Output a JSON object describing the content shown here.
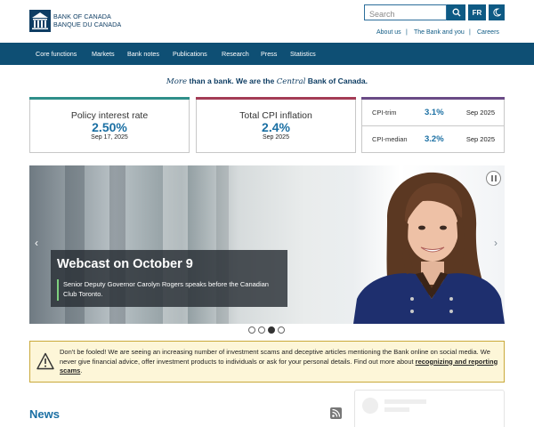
{
  "header": {
    "logo_line1": "BANK OF CANADA",
    "logo_line2": "BANQUE DU CANADA",
    "search_placeholder": "Search",
    "lang_button": "FR",
    "utility_links": [
      "About us",
      "The Bank and you",
      "Careers"
    ]
  },
  "nav": {
    "items": [
      "Core functions",
      "Markets",
      "Bank notes",
      "Publications",
      "Research",
      "Press",
      "Statistics"
    ]
  },
  "tagline": {
    "part1": "More",
    "part2": " than a bank. We are the ",
    "part3": "Central",
    "part4": " Bank of Canada."
  },
  "stats": {
    "policy": {
      "title": "Policy interest rate",
      "value": "2.50%",
      "date": "Sep 17, 2025"
    },
    "cpi": {
      "title": "Total CPI inflation",
      "value": "2.4%",
      "date": "Sep 2025"
    },
    "cpi_trim": {
      "label": "CPI-trim",
      "value": "3.1%",
      "date": "Sep 2025"
    },
    "cpi_median": {
      "label": "CPI-median",
      "value": "3.2%",
      "date": "Sep 2025"
    }
  },
  "carousel": {
    "title": "Webcast on October 9",
    "description": "Senior Deputy Governor Carolyn Rogers speaks before the Canadian Club Toronto.",
    "slide_count": 4,
    "active_slide": 3
  },
  "alert": {
    "text": "Don't be fooled! We are seeing an increasing number of investment scams and deceptive articles mentioning the Bank online on social media. We never give financial advice, offer investment products to individuals or ask for your personal details. Find out more about ",
    "link": "recognizing and reporting scams",
    "end": "."
  },
  "news": {
    "title": "News"
  },
  "colors": {
    "brand": "#0e4f74",
    "accent_blue": "#1a6fa3",
    "policy_bar": "#2f8f8a",
    "cpi_bar": "#a43c56",
    "core_bar": "#6a4a86",
    "alert_bg": "#fdf6d8"
  }
}
